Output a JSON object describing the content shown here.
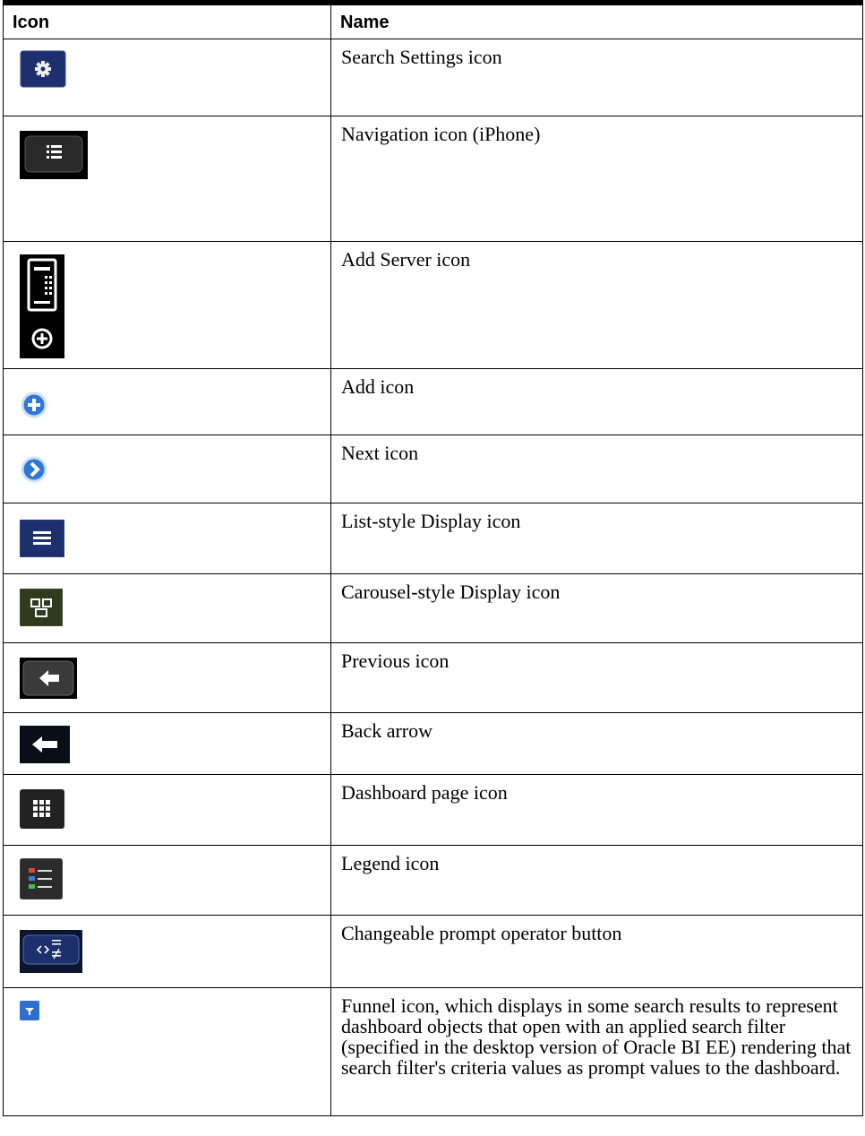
{
  "table": {
    "headers": [
      "Icon",
      "Name"
    ],
    "rows": [
      {
        "icon": "search-settings-icon",
        "name": "Search Settings icon"
      },
      {
        "icon": "navigation-icon",
        "name": "Navigation icon (iPhone)"
      },
      {
        "icon": "add-server-icon",
        "name": "Add Server icon"
      },
      {
        "icon": "add-icon",
        "name": "Add icon"
      },
      {
        "icon": "next-icon",
        "name": "Next icon"
      },
      {
        "icon": "list-style-display-icon",
        "name": "List-style Display icon"
      },
      {
        "icon": "carousel-style-display-icon",
        "name": "Carousel-style Display icon"
      },
      {
        "icon": "previous-icon",
        "name": "Previous icon"
      },
      {
        "icon": "back-arrow-icon",
        "name": "Back arrow"
      },
      {
        "icon": "dashboard-page-icon",
        "name": "Dashboard page icon"
      },
      {
        "icon": "legend-icon",
        "name": "Legend icon"
      },
      {
        "icon": "changeable-prompt-operator-icon",
        "name": "Changeable prompt operator button"
      },
      {
        "icon": "funnel-icon",
        "name": "Funnel icon, which displays in some search results to represent dashboard objects that open with an applied search filter (specified in the desktop version of Oracle BI EE) rendering that search filter's criteria values as prompt values to the dashboard."
      }
    ]
  }
}
